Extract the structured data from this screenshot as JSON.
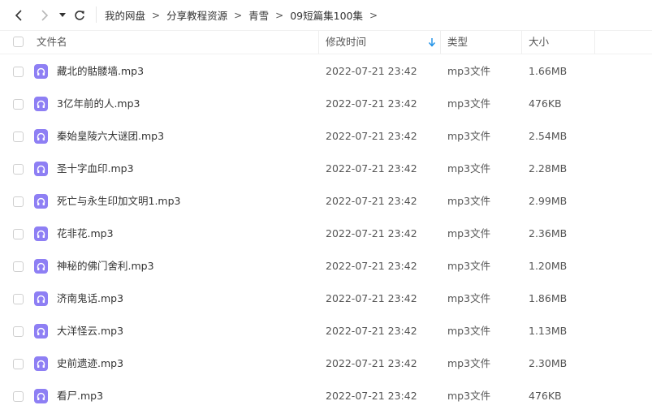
{
  "breadcrumb": {
    "items": [
      "我的网盘",
      "分享教程资源",
      "青雪",
      "09短篇集100集"
    ],
    "separator": ">"
  },
  "header": {
    "name": "文件名",
    "modified": "修改时间",
    "type": "类型",
    "size": "大小",
    "sort_indicator": "arrow-down"
  },
  "accent_color": "#1a8fe6",
  "file_icon_color": "#8e7ff4",
  "files": [
    {
      "name": "藏北的骷髅墙.mp3",
      "modified": "2022-07-21 23:42",
      "type": "mp3文件",
      "size": "1.66MB"
    },
    {
      "name": "3亿年前的人.mp3",
      "modified": "2022-07-21 23:42",
      "type": "mp3文件",
      "size": "476KB"
    },
    {
      "name": "秦始皇陵六大谜团.mp3",
      "modified": "2022-07-21 23:42",
      "type": "mp3文件",
      "size": "2.54MB"
    },
    {
      "name": "圣十字血印.mp3",
      "modified": "2022-07-21 23:42",
      "type": "mp3文件",
      "size": "2.28MB"
    },
    {
      "name": "死亡与永生印加文明1.mp3",
      "modified": "2022-07-21 23:42",
      "type": "mp3文件",
      "size": "2.99MB"
    },
    {
      "name": "花非花.mp3",
      "modified": "2022-07-21 23:42",
      "type": "mp3文件",
      "size": "2.36MB"
    },
    {
      "name": "神秘的佛门舍利.mp3",
      "modified": "2022-07-21 23:42",
      "type": "mp3文件",
      "size": "1.20MB"
    },
    {
      "name": "济南鬼话.mp3",
      "modified": "2022-07-21 23:42",
      "type": "mp3文件",
      "size": "1.86MB"
    },
    {
      "name": "大洋怪云.mp3",
      "modified": "2022-07-21 23:42",
      "type": "mp3文件",
      "size": "1.13MB"
    },
    {
      "name": "史前遗迹.mp3",
      "modified": "2022-07-21 23:42",
      "type": "mp3文件",
      "size": "2.30MB"
    },
    {
      "name": "看尸.mp3",
      "modified": "2022-07-21 23:42",
      "type": "mp3文件",
      "size": "476KB"
    }
  ]
}
